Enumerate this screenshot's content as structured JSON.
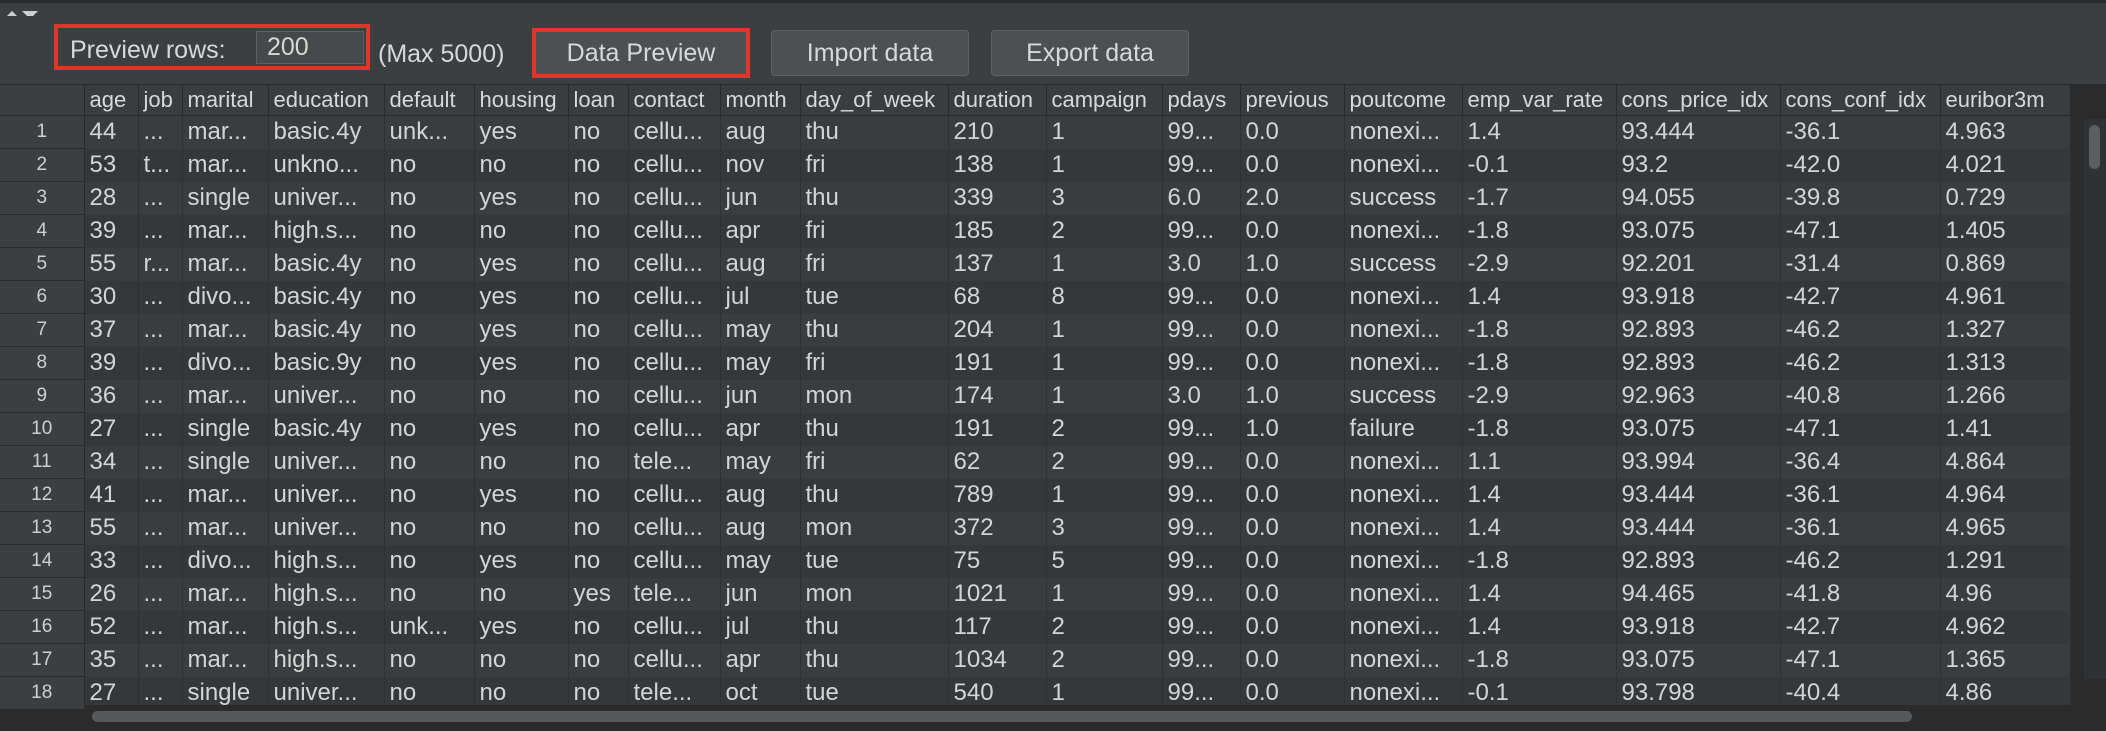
{
  "toolbar": {
    "preview_rows_label": "Preview rows:",
    "preview_rows_value": "200",
    "max_label": "(Max 5000)",
    "data_preview_label": "Data Preview",
    "import_label": "Import data",
    "export_label": "Export data"
  },
  "table": {
    "columns": [
      "age",
      "job",
      "marital",
      "education",
      "default",
      "housing",
      "loan",
      "contact",
      "month",
      "day_of_week",
      "duration",
      "campaign",
      "pdays",
      "previous",
      "poutcome",
      "emp_var_rate",
      "cons_price_idx",
      "cons_conf_idx",
      "euribor3m"
    ],
    "rows": [
      {
        "n": "1",
        "cells": [
          "44",
          "...",
          "mar...",
          "basic.4y",
          "unk...",
          "yes",
          "no",
          "cellu...",
          "aug",
          "thu",
          "210",
          "1",
          "99...",
          "0.0",
          "nonexi...",
          "1.4",
          "93.444",
          "-36.1",
          "4.963"
        ]
      },
      {
        "n": "2",
        "cells": [
          "53",
          "t...",
          "mar...",
          "unkno...",
          "no",
          "no",
          "no",
          "cellu...",
          "nov",
          "fri",
          "138",
          "1",
          "99...",
          "0.0",
          "nonexi...",
          "-0.1",
          "93.2",
          "-42.0",
          "4.021"
        ]
      },
      {
        "n": "3",
        "cells": [
          "28",
          "...",
          "single",
          "univer...",
          "no",
          "yes",
          "no",
          "cellu...",
          "jun",
          "thu",
          "339",
          "3",
          "6.0",
          "2.0",
          "success",
          "-1.7",
          "94.055",
          "-39.8",
          "0.729"
        ]
      },
      {
        "n": "4",
        "cells": [
          "39",
          "...",
          "mar...",
          "high.s...",
          "no",
          "no",
          "no",
          "cellu...",
          "apr",
          "fri",
          "185",
          "2",
          "99...",
          "0.0",
          "nonexi...",
          "-1.8",
          "93.075",
          "-47.1",
          "1.405"
        ]
      },
      {
        "n": "5",
        "cells": [
          "55",
          "r...",
          "mar...",
          "basic.4y",
          "no",
          "yes",
          "no",
          "cellu...",
          "aug",
          "fri",
          "137",
          "1",
          "3.0",
          "1.0",
          "success",
          "-2.9",
          "92.201",
          "-31.4",
          "0.869"
        ]
      },
      {
        "n": "6",
        "cells": [
          "30",
          "...",
          "divo...",
          "basic.4y",
          "no",
          "yes",
          "no",
          "cellu...",
          "jul",
          "tue",
          "68",
          "8",
          "99...",
          "0.0",
          "nonexi...",
          "1.4",
          "93.918",
          "-42.7",
          "4.961"
        ]
      },
      {
        "n": "7",
        "cells": [
          "37",
          "...",
          "mar...",
          "basic.4y",
          "no",
          "yes",
          "no",
          "cellu...",
          "may",
          "thu",
          "204",
          "1",
          "99...",
          "0.0",
          "nonexi...",
          "-1.8",
          "92.893",
          "-46.2",
          "1.327"
        ]
      },
      {
        "n": "8",
        "cells": [
          "39",
          "...",
          "divo...",
          "basic.9y",
          "no",
          "yes",
          "no",
          "cellu...",
          "may",
          "fri",
          "191",
          "1",
          "99...",
          "0.0",
          "nonexi...",
          "-1.8",
          "92.893",
          "-46.2",
          "1.313"
        ]
      },
      {
        "n": "9",
        "cells": [
          "36",
          "...",
          "mar...",
          "univer...",
          "no",
          "no",
          "no",
          "cellu...",
          "jun",
          "mon",
          "174",
          "1",
          "3.0",
          "1.0",
          "success",
          "-2.9",
          "92.963",
          "-40.8",
          "1.266"
        ]
      },
      {
        "n": "10",
        "cells": [
          "27",
          "...",
          "single",
          "basic.4y",
          "no",
          "yes",
          "no",
          "cellu...",
          "apr",
          "thu",
          "191",
          "2",
          "99...",
          "1.0",
          "failure",
          "-1.8",
          "93.075",
          "-47.1",
          "1.41"
        ]
      },
      {
        "n": "11",
        "cells": [
          "34",
          "...",
          "single",
          "univer...",
          "no",
          "no",
          "no",
          "tele...",
          "may",
          "fri",
          "62",
          "2",
          "99...",
          "0.0",
          "nonexi...",
          "1.1",
          "93.994",
          "-36.4",
          "4.864"
        ]
      },
      {
        "n": "12",
        "cells": [
          "41",
          "...",
          "mar...",
          "univer...",
          "no",
          "yes",
          "no",
          "cellu...",
          "aug",
          "thu",
          "789",
          "1",
          "99...",
          "0.0",
          "nonexi...",
          "1.4",
          "93.444",
          "-36.1",
          "4.964"
        ]
      },
      {
        "n": "13",
        "cells": [
          "55",
          "...",
          "mar...",
          "univer...",
          "no",
          "no",
          "no",
          "cellu...",
          "aug",
          "mon",
          "372",
          "3",
          "99...",
          "0.0",
          "nonexi...",
          "1.4",
          "93.444",
          "-36.1",
          "4.965"
        ]
      },
      {
        "n": "14",
        "cells": [
          "33",
          "...",
          "divo...",
          "high.s...",
          "no",
          "yes",
          "no",
          "cellu...",
          "may",
          "tue",
          "75",
          "5",
          "99...",
          "0.0",
          "nonexi...",
          "-1.8",
          "92.893",
          "-46.2",
          "1.291"
        ]
      },
      {
        "n": "15",
        "cells": [
          "26",
          "...",
          "mar...",
          "high.s...",
          "no",
          "no",
          "yes",
          "tele...",
          "jun",
          "mon",
          "1021",
          "1",
          "99...",
          "0.0",
          "nonexi...",
          "1.4",
          "94.465",
          "-41.8",
          "4.96"
        ]
      },
      {
        "n": "16",
        "cells": [
          "52",
          "...",
          "mar...",
          "high.s...",
          "unk...",
          "yes",
          "no",
          "cellu...",
          "jul",
          "thu",
          "117",
          "2",
          "99...",
          "0.0",
          "nonexi...",
          "1.4",
          "93.918",
          "-42.7",
          "4.962"
        ]
      },
      {
        "n": "17",
        "cells": [
          "35",
          "...",
          "mar...",
          "high.s...",
          "no",
          "no",
          "no",
          "cellu...",
          "apr",
          "thu",
          "1034",
          "2",
          "99...",
          "0.0",
          "nonexi...",
          "-1.8",
          "93.075",
          "-47.1",
          "1.365"
        ]
      },
      {
        "n": "18",
        "cells": [
          "27",
          "...",
          "single",
          "univer...",
          "no",
          "no",
          "no",
          "tele...",
          "oct",
          "tue",
          "540",
          "1",
          "99...",
          "0.0",
          "nonexi...",
          "-0.1",
          "93.798",
          "-40.4",
          "4.86"
        ]
      }
    ]
  },
  "colors": {
    "highlight_border": "#e0352b",
    "panel_bg": "#3c3f41",
    "table_bg": "#2b2b2b"
  }
}
